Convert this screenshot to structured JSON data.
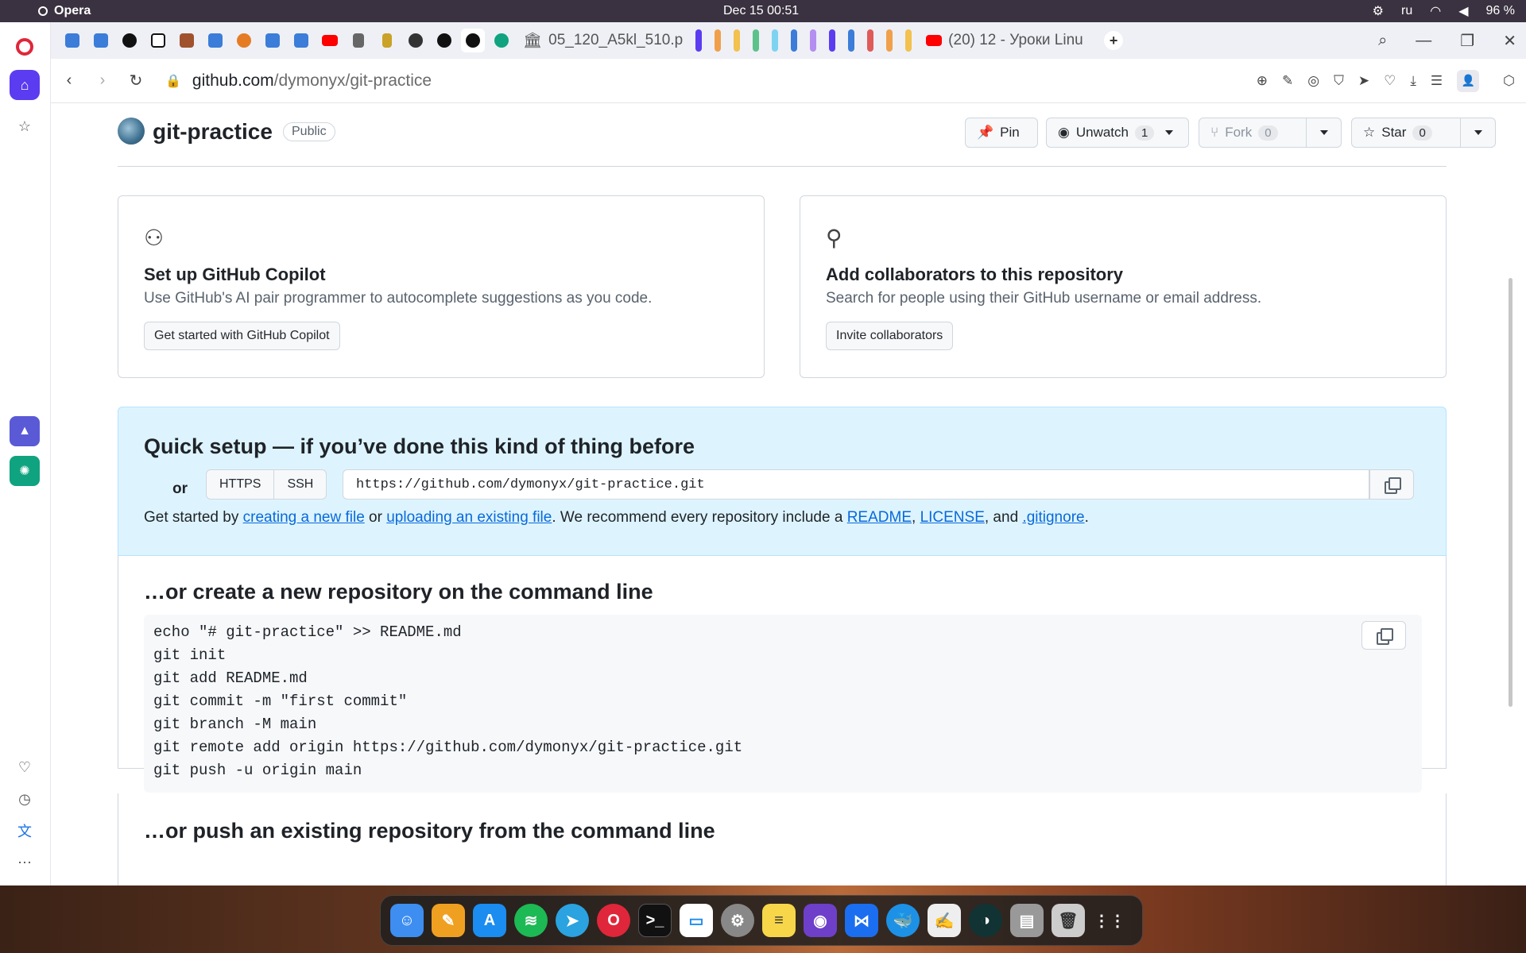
{
  "menubar": {
    "app_name": "Opera",
    "clock": "Dec 15  00:51",
    "lang": "ru",
    "battery": "96 %"
  },
  "tabs": {
    "pdf_tab_title": "05_120_A5kl_510.p",
    "yt_tab_title": "(20) 12 - Уроки Linu"
  },
  "address": {
    "host": "github.com",
    "path": "/dymonyx/git-practice"
  },
  "repo": {
    "name": "git-practice",
    "visibility": "Public",
    "pin_label": "Pin",
    "unwatch_label": "Unwatch",
    "watch_count": "1",
    "fork_label": "Fork",
    "fork_count": "0",
    "star_label": "Star",
    "star_count": "0"
  },
  "cards": {
    "copilot": {
      "title": "Set up GitHub Copilot",
      "desc": "Use GitHub's AI pair programmer to autocomplete suggestions as you code.",
      "button": "Get started with GitHub Copilot"
    },
    "collab": {
      "title": "Add collaborators to this repository",
      "desc": "Search for people using their GitHub username or email address.",
      "button": "Invite collaborators"
    }
  },
  "quick_setup": {
    "title": "Quick setup — if you’ve done this kind of thing before",
    "or": "or",
    "https": "HTTPS",
    "ssh": "SSH",
    "clone_url": "https://github.com/dymonyx/git-practice.git",
    "gs_prefix": "Get started by ",
    "gs_link1": "creating a new file",
    "gs_or": " or ",
    "gs_link2": "uploading an existing file",
    "gs_mid": ". We recommend every repository include a ",
    "gs_readme": "README",
    "gs_comma1": ", ",
    "gs_license": "LICENSE",
    "gs_and": ", and ",
    "gs_gitignore": ".gitignore",
    "gs_end": "."
  },
  "new_repo": {
    "title": "…or create a new repository on the command line",
    "lines": [
      "echo \"# git-practice\" >> README.md",
      "git init",
      "git add README.md",
      "git commit -m \"first commit\"",
      "git branch -M main",
      "git remote add origin https://github.com/dymonyx/git-practice.git",
      "git push -u origin main"
    ]
  },
  "push_existing": {
    "title": "…or push an existing repository from the command line"
  },
  "colors": {
    "accent": "#0969da",
    "quick_bg": "#ddf4ff",
    "opera_red": "#e0263a",
    "opera_home": "#5b3cf0"
  }
}
